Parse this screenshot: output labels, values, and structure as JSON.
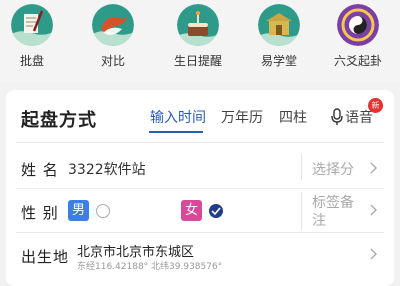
{
  "top_nav": {
    "items": [
      {
        "label": "批盘",
        "icon": "document-pen-icon"
      },
      {
        "label": "对比",
        "icon": "koi-fish-icon"
      },
      {
        "label": "生日提醒",
        "icon": "birthday-cake-icon"
      },
      {
        "label": "易学堂",
        "icon": "school-building-icon"
      },
      {
        "label": "六爻起卦",
        "icon": "bagua-icon"
      }
    ]
  },
  "form": {
    "title": "起盘方式",
    "tabs": [
      "输入时间",
      "万年历",
      "四柱",
      "语音"
    ],
    "active_tab": "输入时间",
    "new_badge": "新",
    "name_label": "姓  名",
    "name_value": "3322软件站",
    "choose_label": "选择分",
    "gender_label": "性  别",
    "male_label": "男",
    "female_label": "女",
    "selected_gender": "女",
    "tag_label_line1": "标签备",
    "tag_label_line2": "注",
    "birthplace_label": "出生地",
    "birthplace_value": "北京市北京市东城区",
    "coordinates": "东经116.42188° 北纬39.938576°"
  },
  "colors": {
    "accent": "#2a5db0",
    "male": "#3d7ee6",
    "female": "#d9499a",
    "badge": "#e83030",
    "icon_teal": "#2e9a8a"
  }
}
